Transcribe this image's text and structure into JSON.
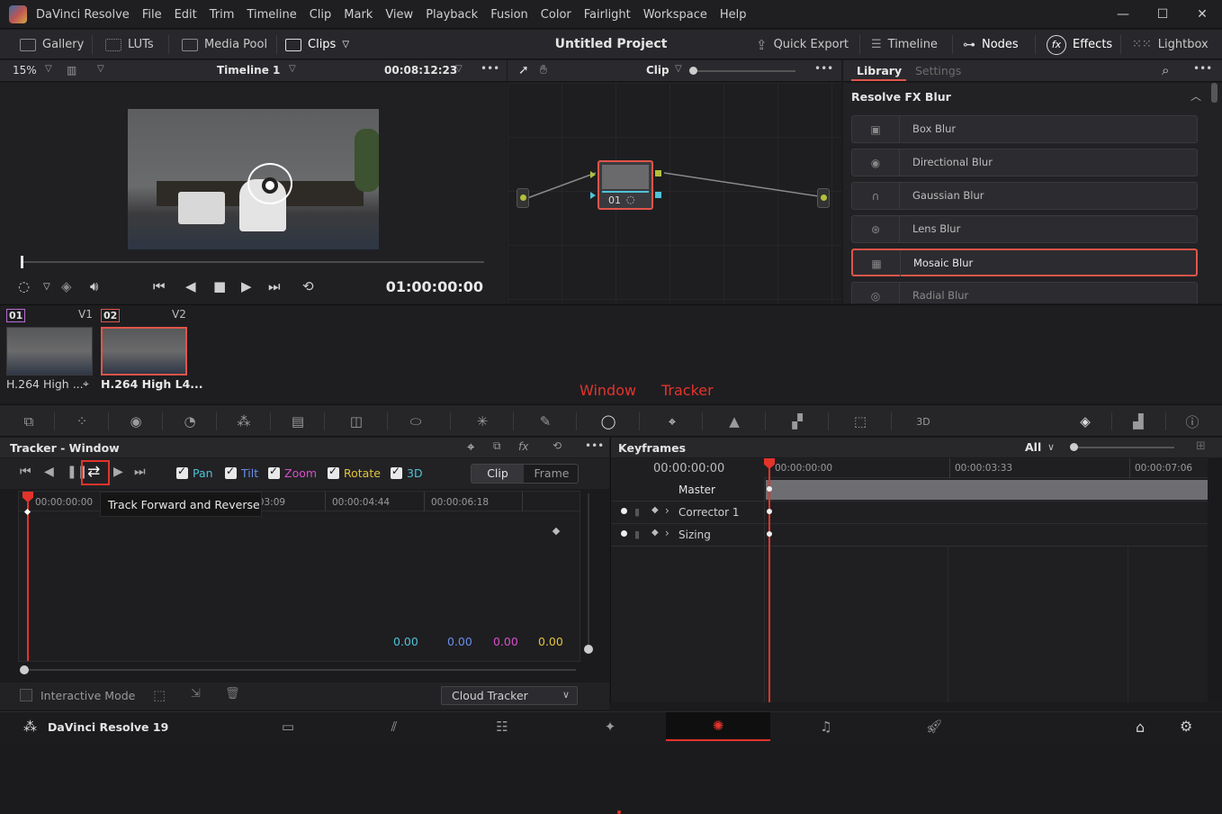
{
  "app": {
    "name": "DaVinci Resolve",
    "version_label": "DaVinci Resolve 19"
  },
  "menu": [
    "File",
    "Edit",
    "Trim",
    "Timeline",
    "Clip",
    "Mark",
    "View",
    "Playback",
    "Fusion",
    "Color",
    "Fairlight",
    "Workspace",
    "Help"
  ],
  "window_controls": [
    "—",
    "☐",
    "✕"
  ],
  "toolbar": {
    "gallery": "Gallery",
    "luts": "LUTs",
    "media_pool": "Media Pool",
    "clips": "Clips",
    "project_title": "Untitled Project",
    "quick_export": "Quick Export",
    "timeline": "Timeline",
    "nodes": "Nodes",
    "effects": "Effects",
    "lightbox": "Lightbox"
  },
  "viewer": {
    "zoom": "15%",
    "timeline_name": "Timeline 1",
    "duration_tc": "00:08:12:23",
    "current_tc": "01:00:00:00"
  },
  "node_editor": {
    "mode": "Clip",
    "node_label": "01"
  },
  "library": {
    "tabs": [
      "Library",
      "Settings"
    ],
    "section": "Resolve FX Blur",
    "items": [
      "Box Blur",
      "Directional Blur",
      "Gaussian Blur",
      "Lens Blur",
      "Mosaic Blur",
      "Radial Blur"
    ],
    "selected": "Mosaic Blur"
  },
  "clips": [
    {
      "num": "01",
      "track": "V1",
      "label": "H.264 High ..."
    },
    {
      "num": "02",
      "track": "V2",
      "label": "H.264 High L4..."
    }
  ],
  "annotations": {
    "window": "Window",
    "tracker": "Tracker"
  },
  "tracker": {
    "title": "Tracker - Window",
    "options": [
      {
        "label": "Pan",
        "color": "#4fc3d6"
      },
      {
        "label": "Tilt",
        "color": "#6a8ee8"
      },
      {
        "label": "Zoom",
        "color": "#d94fc8"
      },
      {
        "label": "Rotate",
        "color": "#e2c43a"
      },
      {
        "label": "3D",
        "color": "#4fc3d6"
      }
    ],
    "mode_tabs": [
      "Clip",
      "Frame"
    ],
    "tooltip": "Track Forward and Reverse",
    "ticks": [
      "00:00:00:00",
      "00:00:03:09",
      "00:00:04:44",
      "00:00:06:18"
    ],
    "values": [
      "0.00",
      "0.00",
      "0.00",
      "0.00"
    ],
    "value_colors": [
      "#4fc3d6",
      "#6a8ee8",
      "#d94fc8",
      "#e2c43a"
    ],
    "interactive_mode": "Interactive Mode",
    "tracker_type": "Cloud Tracker"
  },
  "keyframes": {
    "title": "Keyframes",
    "filter": "All",
    "current_tc": "00:00:00:00",
    "ruler": [
      "00:00:00:00",
      "00:00:03:33",
      "00:00:07:06"
    ],
    "rows": [
      "Master",
      "Corrector 1",
      "Sizing"
    ]
  }
}
